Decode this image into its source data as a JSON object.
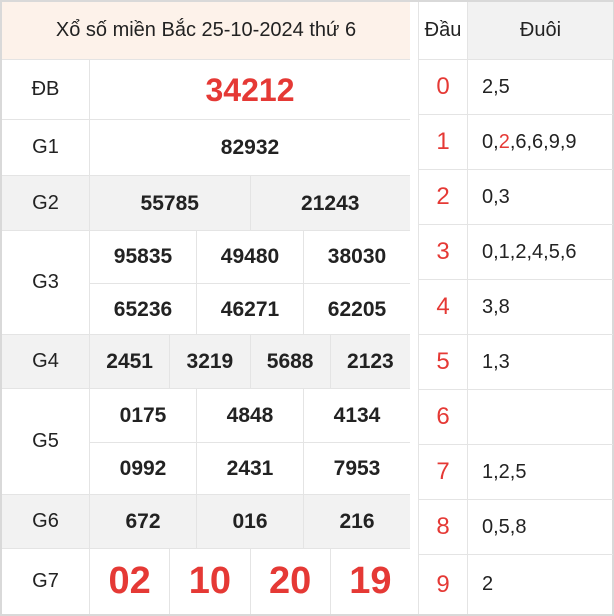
{
  "title": "Xổ số miền Bắc 25-10-2024 thứ 6",
  "prizes": {
    "db": {
      "label": "ĐB",
      "values": [
        "34212"
      ]
    },
    "g1": {
      "label": "G1",
      "values": [
        "82932"
      ]
    },
    "g2": {
      "label": "G2",
      "values": [
        "55785",
        "21243"
      ]
    },
    "g3": {
      "label": "G3",
      "values": [
        "95835",
        "49480",
        "38030",
        "65236",
        "46271",
        "62205"
      ]
    },
    "g4": {
      "label": "G4",
      "values": [
        "2451",
        "3219",
        "5688",
        "2123"
      ]
    },
    "g5": {
      "label": "G5",
      "values": [
        "0175",
        "4848",
        "4134",
        "0992",
        "2431",
        "7953"
      ]
    },
    "g6": {
      "label": "G6",
      "values": [
        "672",
        "016",
        "216"
      ]
    },
    "g7": {
      "label": "G7",
      "values": [
        "02",
        "10",
        "20",
        "19"
      ]
    }
  },
  "loto": {
    "dau_header": "Đầu",
    "duoi_header": "Đuôi",
    "rows": [
      {
        "dau": "0",
        "duoi": "2,5"
      },
      {
        "dau": "1",
        "duoi_parts": [
          "0,",
          "2",
          ",6,6,9,9"
        ]
      },
      {
        "dau": "2",
        "duoi": "0,3"
      },
      {
        "dau": "3",
        "duoi": "0,1,2,4,5,6"
      },
      {
        "dau": "4",
        "duoi": "3,8"
      },
      {
        "dau": "5",
        "duoi": "1,3"
      },
      {
        "dau": "6",
        "duoi": ""
      },
      {
        "dau": "7",
        "duoi": "1,2,5"
      },
      {
        "dau": "8",
        "duoi": "0,5,8"
      },
      {
        "dau": "9",
        "duoi": "2"
      }
    ]
  },
  "colors": {
    "accent_red": "#e53935",
    "header_bg": "#fdf2ea",
    "shade_bg": "#f2f2f2"
  }
}
